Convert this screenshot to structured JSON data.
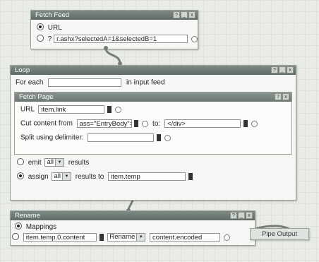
{
  "fetch_feed": {
    "title": "Fetch Feed",
    "url_label": "URL",
    "url_value": "r.ashx?selectedA=1&selectedB=1"
  },
  "loop": {
    "title": "Loop",
    "for_each_label": "For each",
    "in_input_feed": "in input feed",
    "fetch_page": {
      "title": "Fetch Page",
      "url_label": "URL",
      "url_value": "item.link",
      "cut_label": "Cut content from",
      "cut_from_value": "ass=\"EntryBody\">",
      "to_label": "to:",
      "cut_to_value": "</div>",
      "split_label": "Split using delimiter:"
    },
    "emit": {
      "label": "emit",
      "option": "all",
      "suffix": "results"
    },
    "assign": {
      "label": "assign",
      "option": "all",
      "middle": "results to",
      "target": "item.temp"
    }
  },
  "rename": {
    "title": "Rename",
    "mappings_label": "Mappings",
    "source": "item.temp.0.content",
    "op": "Rename",
    "target": "content.encoded"
  },
  "pipe_output": {
    "label": "Pipe Output"
  },
  "icons": [
    "help-icon",
    "minimize-icon",
    "close-icon",
    "radio-icon",
    "terminal-icon",
    "dropdown-icon"
  ],
  "colors": {
    "titlebar": "#6a7570",
    "background": "#e9ebe6",
    "connector": "#777d78"
  }
}
